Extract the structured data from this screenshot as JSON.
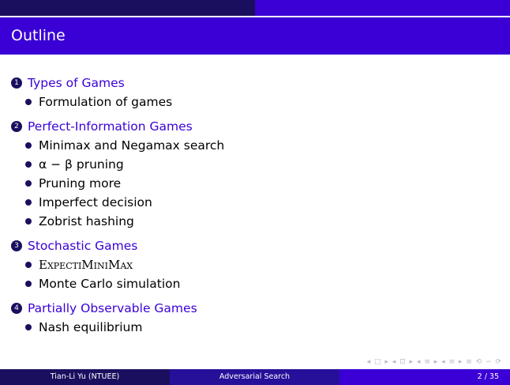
{
  "slide": {
    "title": "Outline",
    "progress_fraction": 0.5
  },
  "outline": {
    "sections": [
      {
        "number": "1",
        "title": "Types of Games",
        "items": [
          "Formulation of games"
        ]
      },
      {
        "number": "2",
        "title": "Perfect-Information Games",
        "items": [
          "Minimax and Negamax search",
          "α − β pruning",
          "Pruning more",
          "Imperfect decision",
          "Zobrist hashing"
        ]
      },
      {
        "number": "3",
        "title": "Stochastic Games",
        "items": [
          "ExpectiMiniMax",
          "Monte Carlo simulation"
        ]
      },
      {
        "number": "4",
        "title": "Partially Observable Games",
        "items": [
          "Nash equilibrium"
        ]
      }
    ]
  },
  "footer": {
    "author": "Tian-Li Yu (NTUEE)",
    "talk_title": "Adversarial Search",
    "page": "2 / 35"
  },
  "nav_symbols": "◂ □ ▸ ◂ ⊡ ▸ ◂ ≡ ▸ ◂ ≡ ▸   ≡   ⟲ ∽ ⟳",
  "colors": {
    "accent": "#3a00d6",
    "dark": "#1a0f5e",
    "mid": "#26109a"
  }
}
